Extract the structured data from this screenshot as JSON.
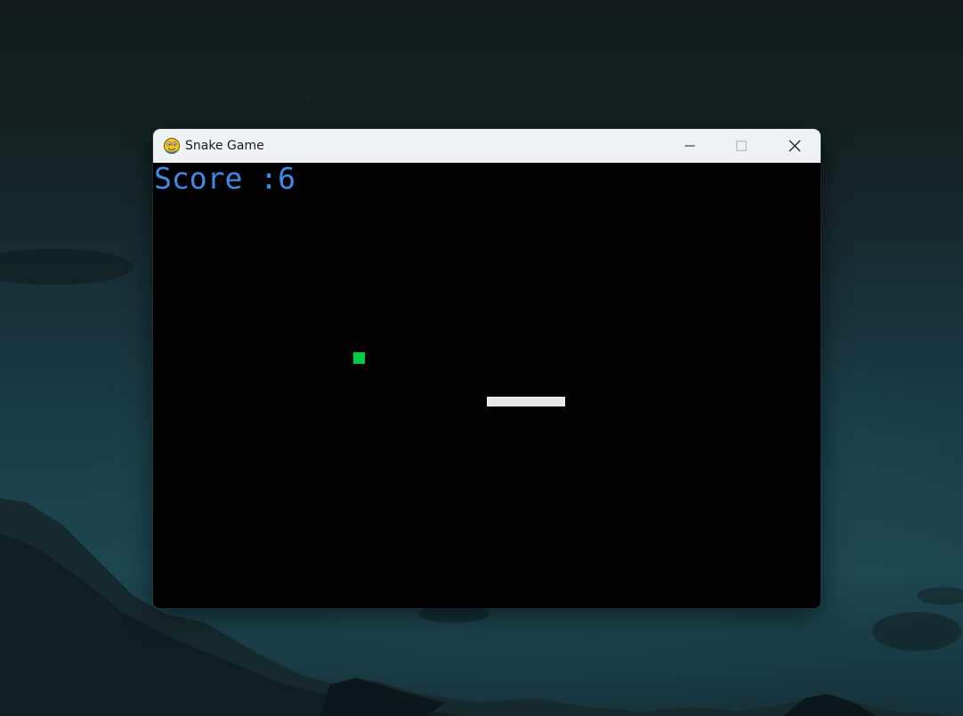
{
  "window": {
    "title": "Snake Game",
    "app_icon": "pygame-snake-icon",
    "controls": {
      "minimize": "minimize-icon",
      "maximize": "maximize-icon",
      "close": "close-icon"
    }
  },
  "game": {
    "score_text": "Score :6",
    "score": 6,
    "colors": {
      "background": "#000000",
      "score_text": "#3d8be6",
      "food": "#00cc44",
      "snake": "#e8e8e8"
    },
    "snake_length_segments": 8
  },
  "desktop": {
    "wallpaper": "night-mountains-crescent-moon"
  }
}
